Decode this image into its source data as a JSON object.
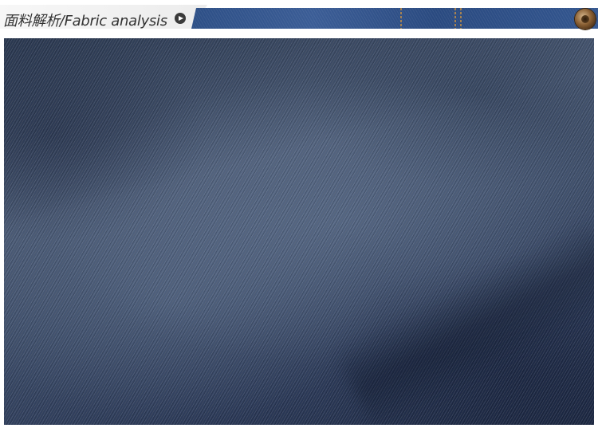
{
  "header": {
    "title": "面料解析/Fabric analysis",
    "arrow_icon": "play-arrow-icon",
    "rivet_icon": "rivet-icon"
  },
  "colors": {
    "denim_banner": "#2f518a",
    "fabric_dark": "#1e2a45",
    "fabric_light": "#4a5a75"
  }
}
